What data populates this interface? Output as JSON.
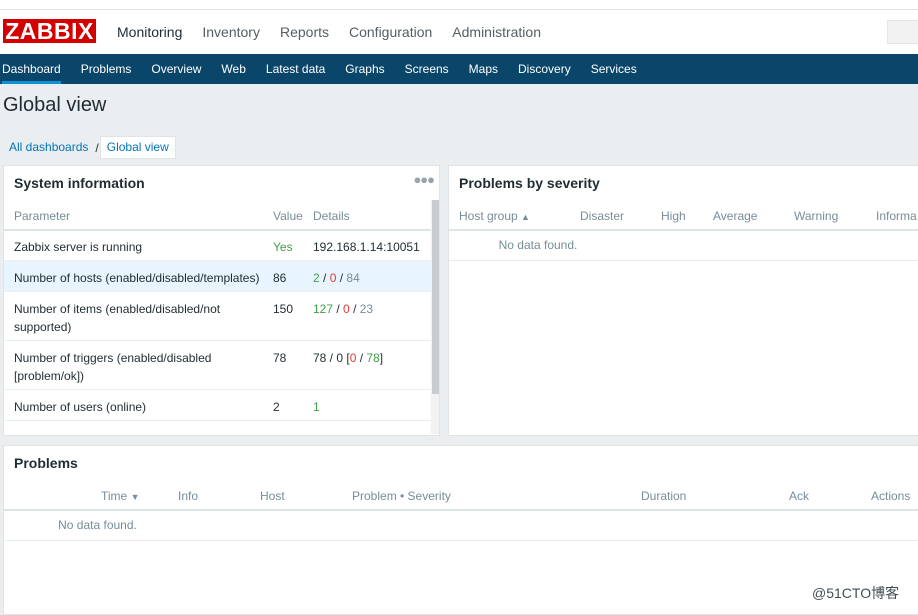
{
  "app": {
    "logo": "ZABBIX"
  },
  "main_menu": [
    {
      "label": "Monitoring",
      "active": true
    },
    {
      "label": "Inventory"
    },
    {
      "label": "Reports"
    },
    {
      "label": "Configuration"
    },
    {
      "label": "Administration"
    }
  ],
  "sub_menu": [
    {
      "label": "Dashboard",
      "active": true
    },
    {
      "label": "Problems"
    },
    {
      "label": "Overview"
    },
    {
      "label": "Web"
    },
    {
      "label": "Latest data"
    },
    {
      "label": "Graphs"
    },
    {
      "label": "Screens"
    },
    {
      "label": "Maps"
    },
    {
      "label": "Discovery"
    },
    {
      "label": "Services"
    }
  ],
  "page": {
    "title": "Global view",
    "breadcrumb": [
      "All dashboards",
      "Global view"
    ],
    "breadcrumb_sep": "/"
  },
  "system_info": {
    "title": "System information",
    "menu_icon": "more-dots-icon",
    "columns": [
      "Parameter",
      "Value",
      "Details"
    ],
    "rows": [
      {
        "param": "Zabbix server is running",
        "value": "Yes",
        "details": "192.168.1.14:10051"
      },
      {
        "param": "Number of hosts (enabled/disabled/templates)",
        "value": "86",
        "d1": "2",
        "s1": " / ",
        "d2": "0",
        "s2": " / ",
        "d3": "84"
      },
      {
        "param": "Number of items (enabled/disabled/not supported)",
        "value": "150",
        "d1": "127",
        "s1": " / ",
        "d2": "0",
        "s2": " / ",
        "d3": "23"
      },
      {
        "param": "Number of triggers (enabled/disabled [problem/ok])",
        "value": "78",
        "d0": "78 / 0 [",
        "d1": "0",
        "s1": " / ",
        "d2": "78",
        "s2": "]"
      },
      {
        "param": "Number of users (online)",
        "value": "2",
        "d1": "1"
      }
    ]
  },
  "problems_by_severity": {
    "title": "Problems by severity",
    "columns": [
      "Host group",
      "Disaster",
      "High",
      "Average",
      "Warning",
      "Informa"
    ],
    "sort_icon": "sort-asc-icon",
    "empty": "No data found."
  },
  "problems": {
    "title": "Problems",
    "columns": [
      "Time",
      "Info",
      "Host",
      "Problem • Severity",
      "Duration",
      "Ack",
      "Actions"
    ],
    "sort_icon": "sort-desc-icon",
    "empty": "No data found."
  },
  "watermark": "@51CTO博客",
  "colors": {
    "brand": "#d40000",
    "nav": "#0a466a",
    "link": "#0275b8",
    "ok": "#429e47",
    "problem": "#e33734"
  }
}
